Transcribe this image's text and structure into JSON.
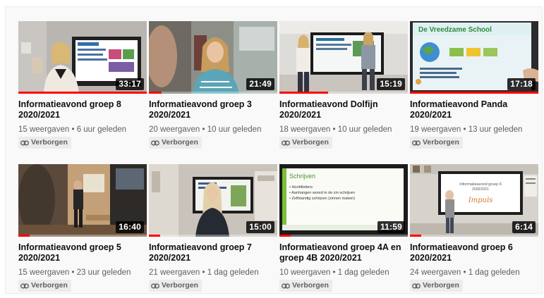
{
  "videos": [
    {
      "title_line1": "Informatieavond groep 8",
      "title_line2": "2020/2021",
      "views": "15 weergaven",
      "age": "6 uur geleden",
      "duration": "33:17",
      "visibility": "Verborgen",
      "watched_fraction": 1.0
    },
    {
      "title_line1": "Informatieavond groep 3",
      "title_line2": "2020/2021",
      "views": "20 weergaven",
      "age": "10 uur geleden",
      "duration": "21:49",
      "visibility": "Verborgen",
      "watched_fraction": 0.1
    },
    {
      "title_line1": "Informatieavond Dolfijn",
      "title_line2": "2020/2021",
      "views": "18 weergaven",
      "age": "10 uur geleden",
      "duration": "15:19",
      "visibility": "Verborgen",
      "watched_fraction": 0.38
    },
    {
      "title_line1": "Informatieavond Panda",
      "title_line2": "2020/2021",
      "views": "19 weergaven",
      "age": "13 uur geleden",
      "duration": "17:18",
      "visibility": "Verborgen",
      "watched_fraction": 1.0
    },
    {
      "title_line1": "Informatieavond groep 5",
      "title_line2": "2020/2021",
      "views": "15 weergaven",
      "age": "23 uur geleden",
      "duration": "16:40",
      "visibility": "Verborgen",
      "watched_fraction": 0.09
    },
    {
      "title_line1": "Informatieavond groep 7",
      "title_line2": "2020/2021",
      "views": "21 weergaven",
      "age": "1 dag geleden",
      "duration": "15:00",
      "visibility": "Verborgen",
      "watched_fraction": 0.09
    },
    {
      "title_line1": "Informatieavond groep 4A en",
      "title_line2": "groep 4B 2020/2021",
      "views": "10 weergaven",
      "age": "1 dag geleden",
      "duration": "11:59",
      "visibility": "Verborgen",
      "watched_fraction": 0.09
    },
    {
      "title_line1": "Informatieavond groep 6",
      "title_line2": "2020/2021",
      "views": "24 weergaven",
      "age": "1 dag geleden",
      "duration": "6:14",
      "visibility": "Verborgen",
      "watched_fraction": 0.09
    }
  ],
  "thumbnail_slides": {
    "v4_heading": "De Vreedzame School",
    "v7_heading": "Schrijven",
    "v7_bullets": [
      "Hoofdletters",
      "Aanhangen woord in de zin schrijven",
      "Zelfstandig schrijven (zinnen maken)"
    ],
    "v8_line1": "Informatieavond groep 6",
    "v8_line2": "2020/2021",
    "v8_logo": "Impuls"
  },
  "colors": {
    "accent": "#ff0000",
    "badge_bg": "#ececec",
    "meta_text": "#606060",
    "title_text": "#0f0f0f"
  },
  "icons": {
    "visibility": "link-icon"
  }
}
